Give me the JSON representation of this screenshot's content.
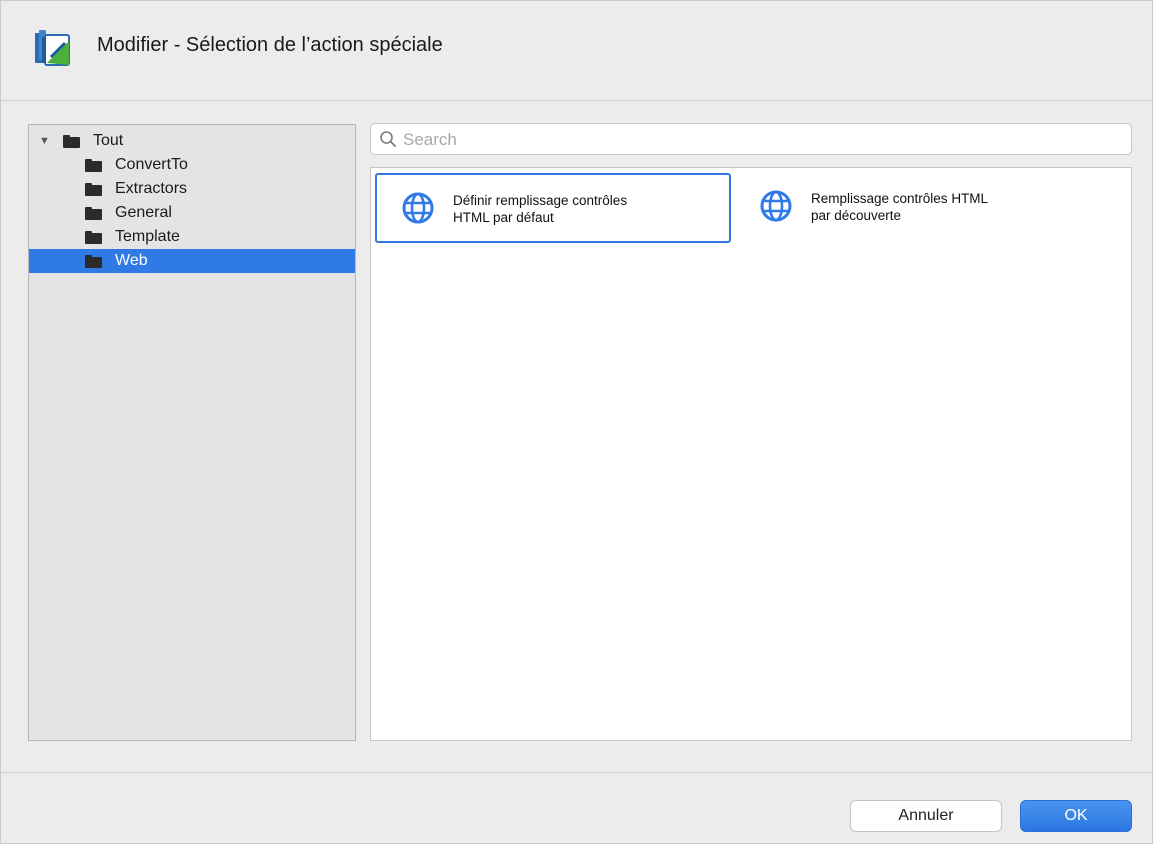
{
  "window": {
    "title": "Modifier - Sélection de l’action spéciale"
  },
  "tree": {
    "root": {
      "label": "Tout",
      "expanded": true
    },
    "items": [
      {
        "label": "ConvertTo"
      },
      {
        "label": "Extractors"
      },
      {
        "label": "General"
      },
      {
        "label": "Template"
      },
      {
        "label": "Web",
        "selected": true
      }
    ]
  },
  "search": {
    "placeholder": "Search",
    "value": ""
  },
  "actions": [
    {
      "line1": "Définir remplissage contrôles",
      "line2": "HTML par défaut",
      "icon": "globe-icon",
      "selected": true
    },
    {
      "line1": "Remplissage contrôles HTML",
      "line2": "par découverte",
      "icon": "globe-icon",
      "selected": false
    }
  ],
  "buttons": {
    "cancel_label": "Annuler",
    "ok_label": "OK"
  },
  "colors": {
    "accent": "#2f7ae5",
    "window_bg": "#ececec",
    "tree_bg": "#e4e4e4"
  }
}
